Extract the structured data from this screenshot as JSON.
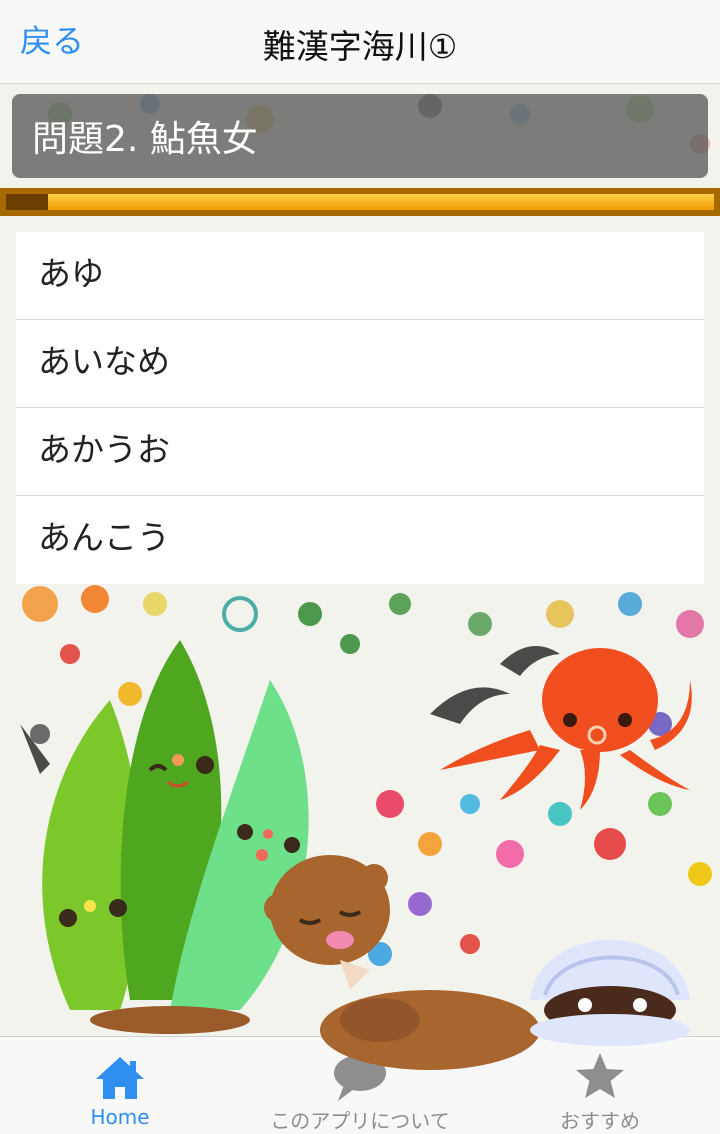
{
  "nav": {
    "back_label": "戻る",
    "title": "難漢字海川①"
  },
  "question": {
    "text": "問題2. 鮎魚女"
  },
  "progress": {
    "fraction": 0.94
  },
  "answers": [
    {
      "label": "あゆ"
    },
    {
      "label": "あいなめ"
    },
    {
      "label": "あかうお"
    },
    {
      "label": "あんこう"
    }
  ],
  "tabs": [
    {
      "label": "Home",
      "icon": "home-icon",
      "active": true
    },
    {
      "label": "このアプリについて",
      "icon": "chat-bubble-icon",
      "active": false
    },
    {
      "label": "おすすめ",
      "icon": "star-icon",
      "active": false
    }
  ],
  "colors": {
    "accent": "#2f8ff0",
    "progress_fill": "#f5a300",
    "progress_track": "#6b3d00"
  }
}
